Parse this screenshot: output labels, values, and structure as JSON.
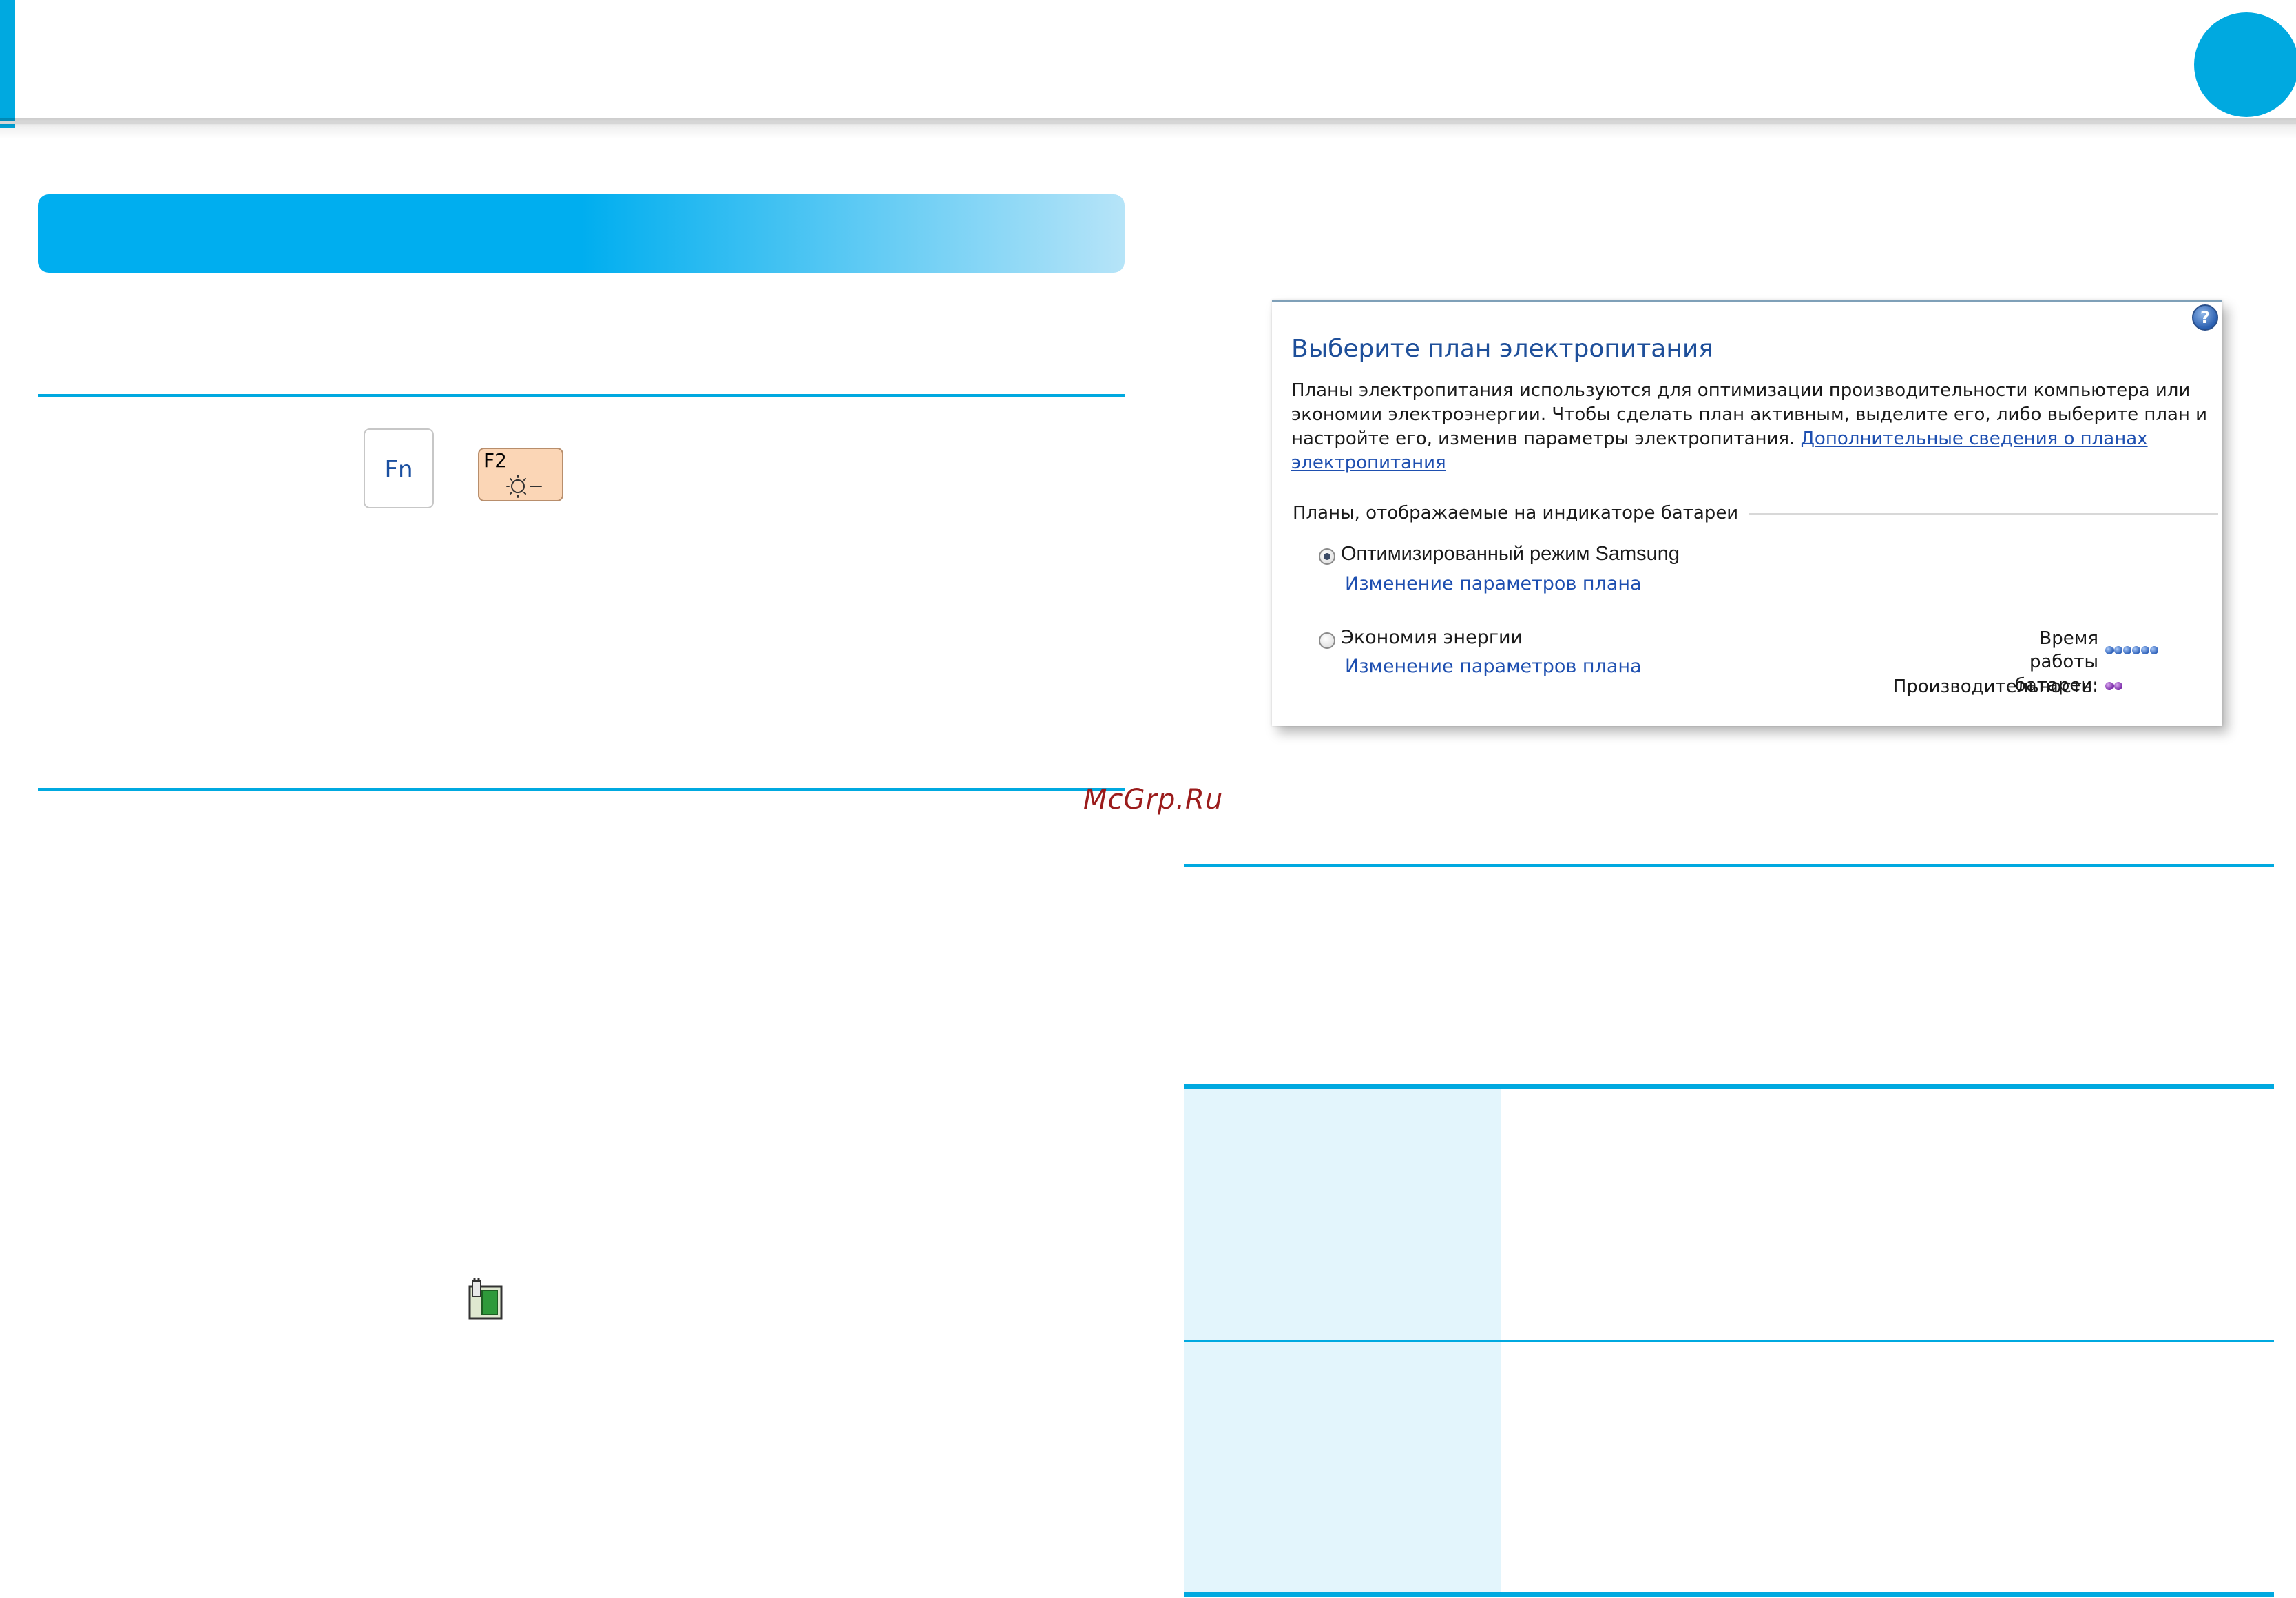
{
  "header": {
    "accent_color": "#00a9e0"
  },
  "keys": {
    "fn_label": "Fn",
    "f2_label": "F2",
    "f2_icon": "brightness-down-icon"
  },
  "indicator_icon": "battery-power-icon",
  "watermark": "McGrp.Ru",
  "power_plan_window": {
    "title": "Выберите план электропитания",
    "description": "Планы электропитания используются для оптимизации производительности компьютера или экономии электроэнергии. Чтобы сделать план активным, выделите его, либо выберите план и настройте его, изменив параметры электропитания.",
    "more_info_link": "Дополнительные сведения о планах электропитания",
    "group_label": "Планы, отображаемые на индикаторе батареи",
    "plans": [
      {
        "name": "Оптимизированный режим Samsung",
        "link": "Изменение параметров плана",
        "selected": true
      },
      {
        "name": "Экономия энергии",
        "link": "Изменение параметров плана",
        "selected": false
      }
    ],
    "battery_life_label": "Время работы батареи:",
    "battery_life_level": 6,
    "performance_label": "Производительность:",
    "performance_level": 2
  }
}
